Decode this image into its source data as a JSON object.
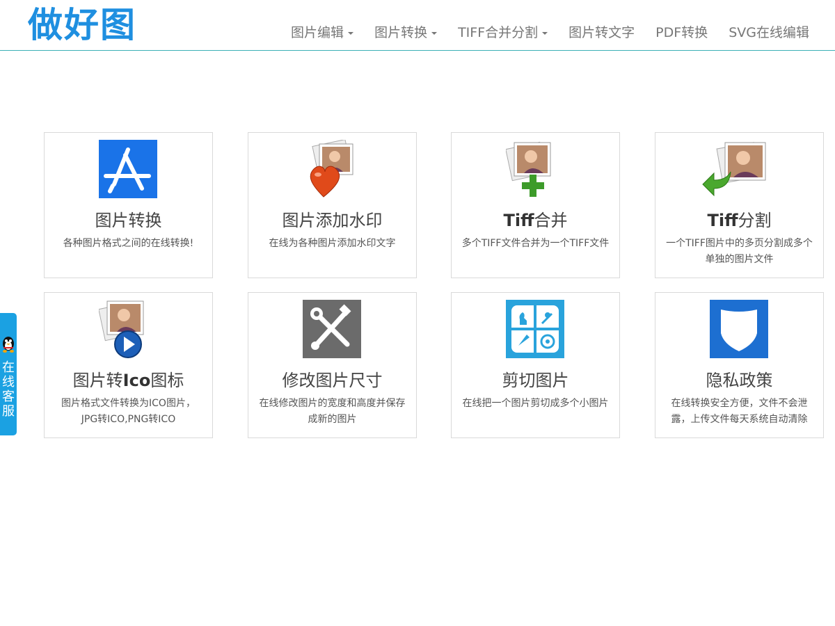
{
  "header": {
    "logo": "做好图",
    "nav": [
      {
        "label": "图片编辑",
        "dropdown": true
      },
      {
        "label": "图片转换",
        "dropdown": true
      },
      {
        "label": "TIFF合并分割",
        "dropdown": true
      },
      {
        "label": "图片转文字",
        "dropdown": false
      },
      {
        "label": "PDF转换",
        "dropdown": false
      },
      {
        "label": "SVG在线编辑",
        "dropdown": false
      }
    ]
  },
  "cards": [
    {
      "title": "图片转换",
      "desc": "各种图片格式之间的在线转换!",
      "icon": "app-store-icon"
    },
    {
      "title": "图片添加水印",
      "desc": "在线为各种图片添加水印文字",
      "icon": "photo-heart-icon"
    },
    {
      "title_latin": "Tiff",
      "title_rest": "合并",
      "desc": "多个TIFF文件合并为一个TIFF文件",
      "icon": "photo-plus-icon"
    },
    {
      "title_latin": "Tiff",
      "title_rest": "分割",
      "desc": "一个TIFF图片中的多页分割成多个单独的图片文件",
      "icon": "photo-arrow-icon"
    },
    {
      "title_pre": "图片转",
      "title_latin": "Ico",
      "title_rest": "图标",
      "desc": "图片格式文件转换为ICO图片，JPG转ICO,PNG转ICO",
      "icon": "photo-play-icon"
    },
    {
      "title": "修改图片尺寸",
      "desc": "在线修改图片的宽度和高度并保存成新的图片",
      "icon": "tools-icon"
    },
    {
      "title": "剪切图片",
      "desc": "在线把一个图片剪切成多个小图片",
      "icon": "crop-grid-icon"
    },
    {
      "title": "隐私政策",
      "desc": "在线转换安全方便，文件不会泄露，上传文件每天系统自动清除",
      "icon": "shield-icon"
    }
  ],
  "side_tab": {
    "label": "在线客服",
    "icon": "qq-penguin-icon"
  },
  "colors": {
    "brand": "#1f8fe0",
    "nav_line": "#3bb0b6",
    "side_tab": "#1ba1e2"
  }
}
